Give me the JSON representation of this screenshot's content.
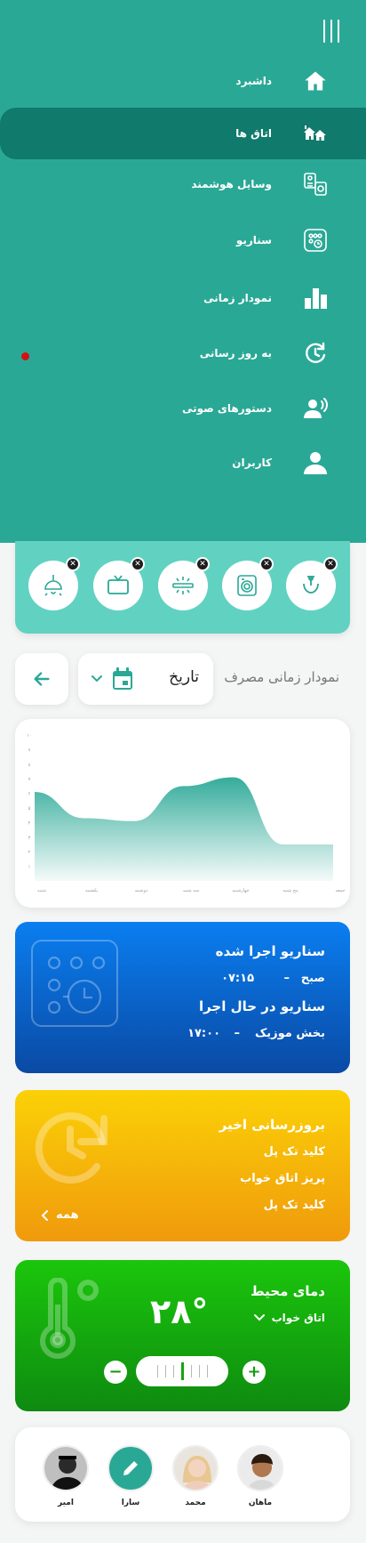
{
  "menu": {
    "items": [
      {
        "label": "داشبرد",
        "icon": "home-icon",
        "active": false
      },
      {
        "label": "اتاق ها",
        "icon": "rooms-icon",
        "active": true
      },
      {
        "label": "وسایل هوشمند",
        "icon": "smart-devices-icon",
        "active": false
      },
      {
        "label": "سناریو",
        "icon": "scenario-icon",
        "active": false
      },
      {
        "label": "نمودار زمانی",
        "icon": "bar-chart-icon",
        "active": false
      },
      {
        "label": "به روز رسانی",
        "icon": "update-icon",
        "active": false
      },
      {
        "label": "دستورهای صوتی",
        "icon": "voice-command-icon",
        "active": false
      },
      {
        "label": "کاربران",
        "icon": "user-icon",
        "active": false
      }
    ],
    "notification_color": "#d31313"
  },
  "devices": [
    {
      "icon": "ceiling-lamp-icon"
    },
    {
      "icon": "tv-icon"
    },
    {
      "icon": "led-light-icon"
    },
    {
      "icon": "washing-machine-icon"
    },
    {
      "icon": "faucet-icon"
    }
  ],
  "chart_header": {
    "title": "نمودار زمانی مصرف",
    "date_label": "تاریخ"
  },
  "chart_data": {
    "type": "area",
    "title": "",
    "categories": [
      "شنبه",
      "یکشنبه",
      "دوشنبه",
      "سه شنبه",
      "چهارشنبه",
      "پنج شنبه",
      "جمعه"
    ],
    "y_ticks": [
      "۱",
      "۲",
      "۳",
      "۴",
      "۵",
      "۶",
      "۷",
      "۸",
      "۹",
      "۱۰"
    ],
    "series": [
      {
        "values": [
          6.1,
          4.3,
          4.1,
          6.5,
          7.1,
          2.5,
          2.5
        ]
      }
    ],
    "ylim": [
      0,
      10
    ],
    "color": "#2aa896"
  },
  "scenario_card": {
    "done_title": "سناریو اجرا شده",
    "done_name": "صبح",
    "done_dash": "–",
    "done_time": "۰۷:۱۵",
    "running_title": "سناریو در حال اجرا",
    "running_name": "بخش موزیک",
    "running_dash": "–",
    "running_time": "۱۷:۰۰"
  },
  "updates_card": {
    "title": "بروزرسانی اخیر",
    "items": [
      "کلید تک پل",
      "پریز اتاق خواب",
      "کلید تک پل"
    ],
    "more_label": "همه"
  },
  "temperature_card": {
    "title": "دمای محیط",
    "room": "اتاق خواب",
    "value": "۲۸°",
    "minus": "−",
    "plus": "+"
  },
  "users": [
    {
      "name": "امیر"
    },
    {
      "name": "سارا"
    },
    {
      "name": "محمد"
    },
    {
      "name": "ماهان"
    }
  ]
}
